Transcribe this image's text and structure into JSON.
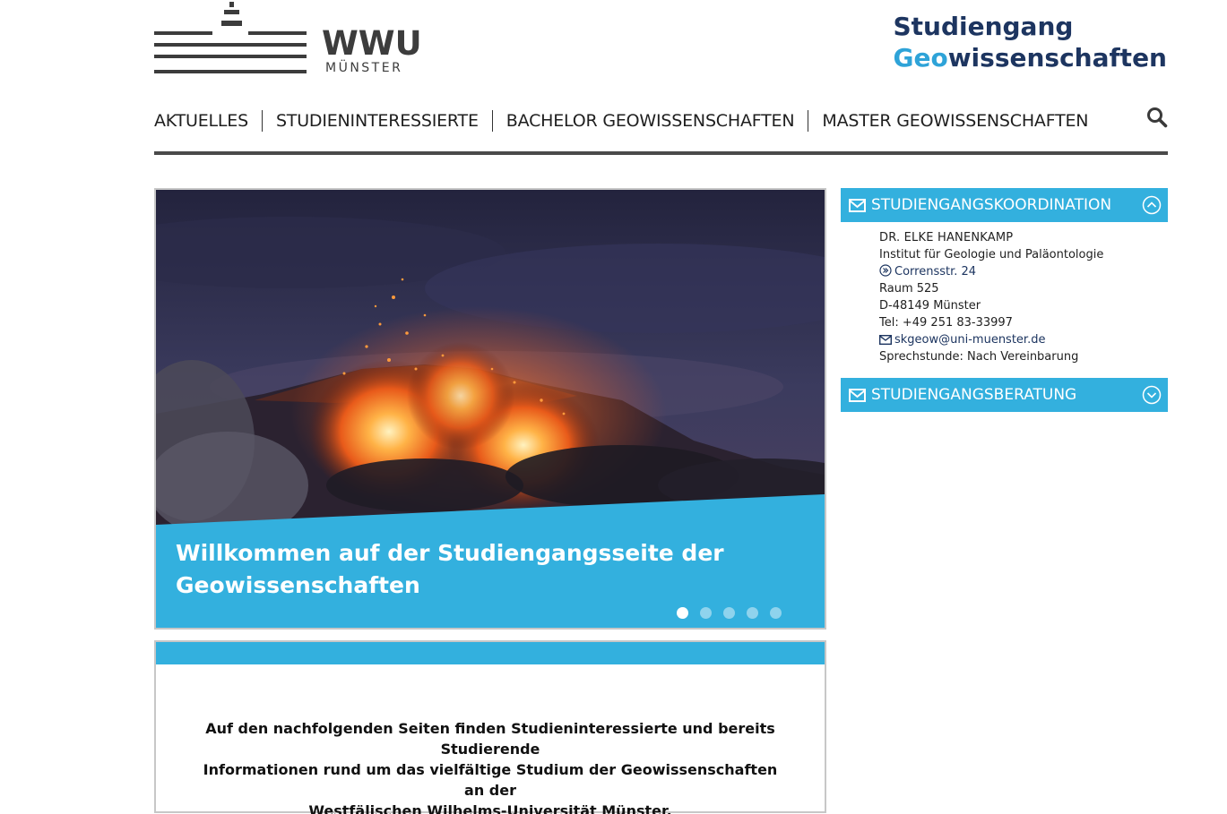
{
  "header": {
    "logo_word": "WWU",
    "logo_sub": "MÜNSTER",
    "site_title_line1": "Studiengang",
    "site_title_geo": "Geo",
    "site_title_rest": "wissenschaften"
  },
  "nav": {
    "items": [
      {
        "label": "AKTUELLES"
      },
      {
        "label": "STUDIENINTERESSIERTE"
      },
      {
        "label": "BACHELOR GEOWISSENSCHAFTEN"
      },
      {
        "label": "MASTER GEOWISSENSCHAFTEN"
      }
    ],
    "search_icon": "search-icon"
  },
  "hero": {
    "caption_line1": "Willkommen auf der Studiengangsseite der",
    "caption_line2": "Geowissenschaften",
    "slide_count": 5,
    "active_slide": 1
  },
  "intro": {
    "line1": "Auf den nachfolgenden Seiten finden Studieninteressierte und bereits Studierende",
    "line2": "Informationen rund um das vielfältige Studium der Geowissenschaften an der",
    "line3": "Westfälischen Wilhelms-Universität Münster."
  },
  "sidebar": {
    "koordination": {
      "title": "STUDIENGANGSKOORDINATION",
      "expanded": true,
      "name": "DR. ELKE HANENKAMP",
      "institute": "Institut für Geologie und Paläontologie",
      "street": "Corrensstr. 24",
      "room": "Raum 525",
      "city": "D-48149 Münster",
      "phone": "Tel: +49 251 83-33997",
      "email": "skgeow@uni-muenster.de",
      "hours": "Sprechstunde: Nach Vereinbarung"
    },
    "beratung": {
      "title": "STUDIENGANGSBERATUNG",
      "expanded": false
    }
  },
  "colors": {
    "accent": "#33b0de",
    "navy": "#1d3560",
    "rule": "#4a4a4a"
  }
}
